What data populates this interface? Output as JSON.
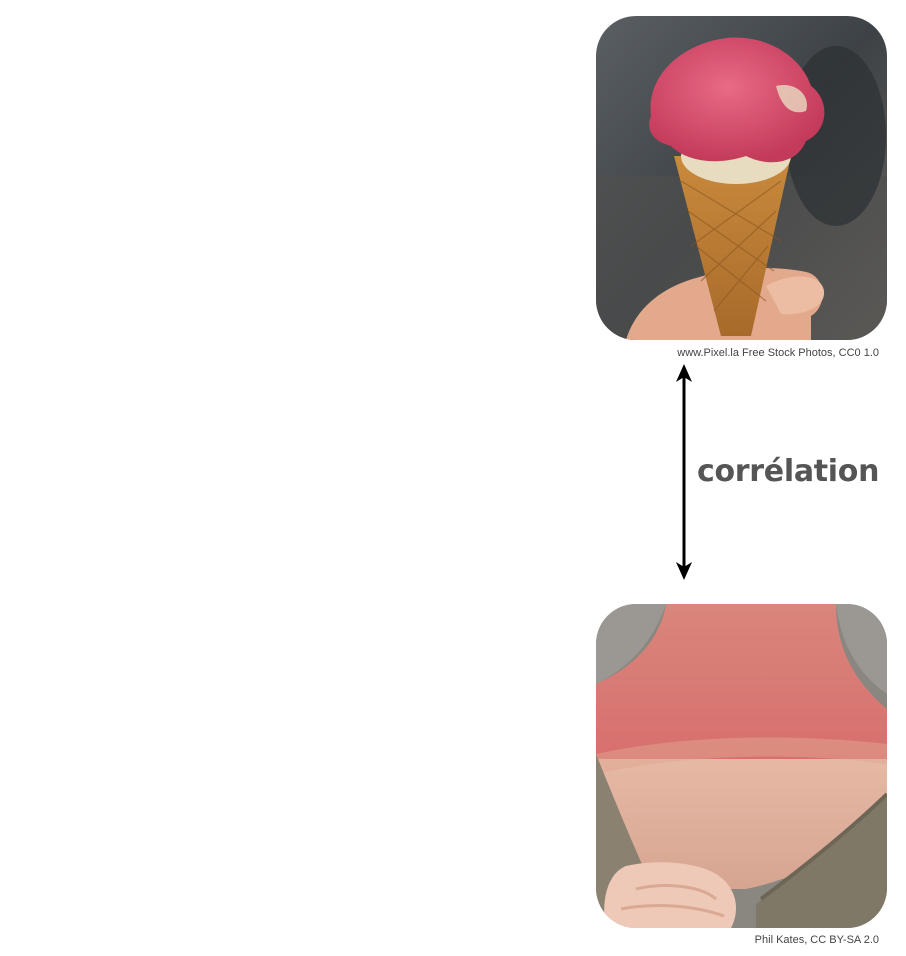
{
  "photos": [
    {
      "subject": "ice-cream-cone",
      "credit": "www.Pixel.la Free Stock Photos, CC0 1.0"
    },
    {
      "subject": "sunburned-neck",
      "credit": "Phil Kates, CC BY-SA 2.0"
    }
  ],
  "relation": {
    "label": "corrélation",
    "arrow": "double-headed vertical",
    "color": "#555555"
  },
  "colors": {
    "arrow": "#000000",
    "caption": "#444444"
  }
}
